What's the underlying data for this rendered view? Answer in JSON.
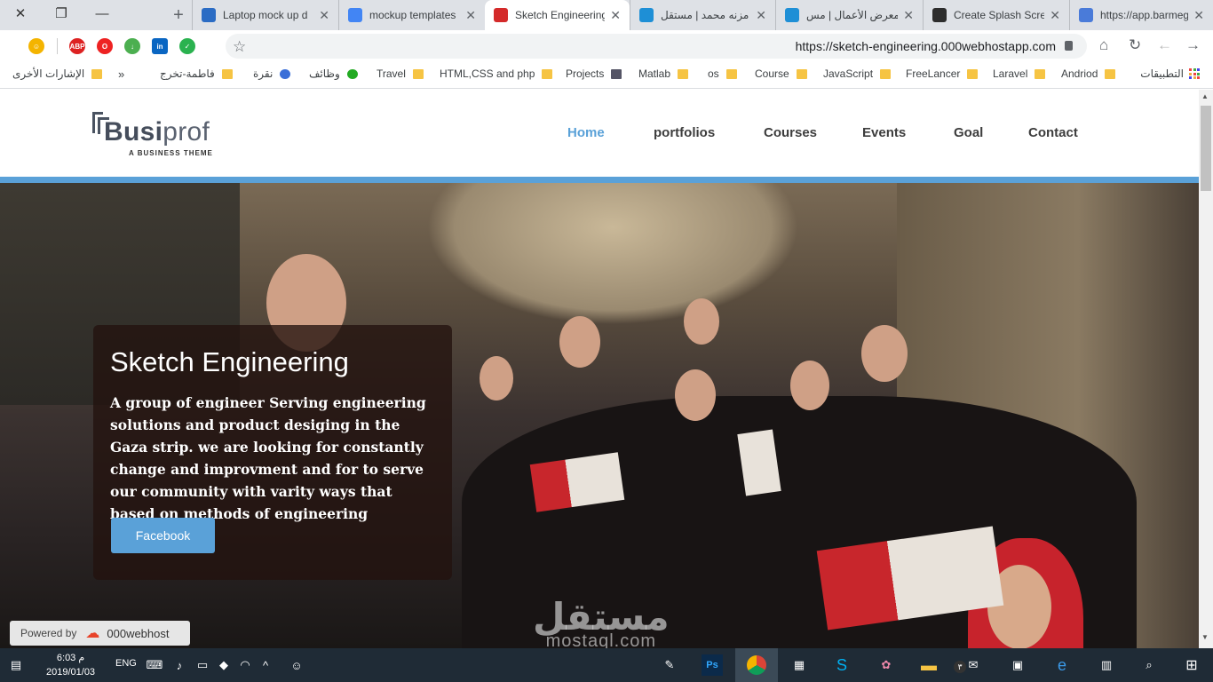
{
  "browser": {
    "tabs": [
      {
        "title": "https://app.barmeg",
        "favicon_color": "#4a7bd9"
      },
      {
        "title": "Create Splash Scre",
        "favicon_color": "#2d2d2d"
      },
      {
        "title": "معرض الأعمال | مس",
        "favicon_color": "#1e8fd6"
      },
      {
        "title": "مزنه محمد | مستقل",
        "favicon_color": "#1e8fd6"
      },
      {
        "title": "Sketch Engineering",
        "favicon_color": "#d42a2a"
      },
      {
        "title": "mockup templates",
        "favicon_color": "#4285f4"
      },
      {
        "title": "Laptop mock up d",
        "favicon_color": "#2b6cc4"
      }
    ],
    "url": "https://sketch-engineering.000webhostapp.com",
    "bookmarks": [
      "التطبيقات",
      "Andriod",
      "Laravel",
      "FreeLancer",
      "JavaScript",
      "Course",
      "os",
      "Matlab",
      "Projects",
      "HTML,CSS and php",
      "Travel",
      "وظائف",
      "نقرة",
      "فاطمة-تخرج",
      "الإشارات الأخرى"
    ],
    "bookmarks_more": "»",
    "extensions": [
      {
        "name": "emoji-extension-icon",
        "label": "",
        "color": "#f4b400"
      },
      {
        "name": "adblock-plus-icon",
        "label": "ABP",
        "color": "#d22"
      },
      {
        "name": "opera-icon",
        "label": "O",
        "color": "#e22"
      },
      {
        "name": "download-extension-icon",
        "label": "",
        "color": "#4caf50"
      },
      {
        "name": "linkedin-icon",
        "label": "in",
        "color": "#0a66c2"
      },
      {
        "name": "grammarly-icon",
        "label": "✓",
        "color": "#2ab24f"
      }
    ]
  },
  "site": {
    "logo_main": "Busi",
    "logo_accent": "prof",
    "logo_tagline": "A BUSINESS THEME",
    "nav": [
      "Home",
      "portfolios",
      "Courses",
      "Events",
      "Goal",
      "Contact"
    ],
    "active_nav": "Home",
    "accent_color": "#5aa1d8",
    "hero": {
      "title": "Sketch Engineering",
      "text": "A group of engineer Serving engineering solutions and product desiging in the Gaza strip. we are looking for constantly change and improvment and for to serve our community with varity ways that based on methods of engineering",
      "button": "Facebook"
    },
    "powered_label": "Powered by",
    "powered_brand": "000webhost",
    "watermark_ar": "مستقل",
    "watermark_en": "mostaql.com"
  },
  "taskbar": {
    "time": "6:03 م",
    "date": "2019/01/03",
    "language": "ENG",
    "notification_count": "٣"
  }
}
